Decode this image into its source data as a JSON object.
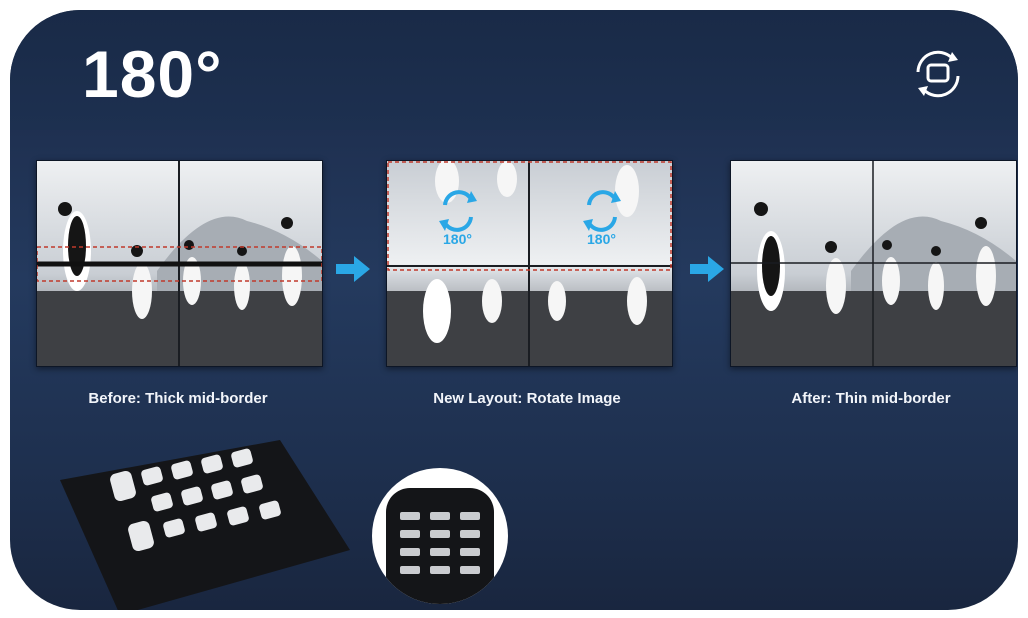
{
  "header": {
    "title": "180°",
    "icon": "rotate-screen-icon"
  },
  "panels": [
    {
      "caption": "Before: Thick mid-border"
    },
    {
      "caption": "New Layout: Rotate Image",
      "rotate_labels": [
        "180°",
        "180°"
      ]
    },
    {
      "caption": "After: Thin mid-border"
    }
  ],
  "colors": {
    "background": "#1f3152",
    "accent_arrow": "#2aa7e6",
    "dashed_border": "#c0392b"
  }
}
